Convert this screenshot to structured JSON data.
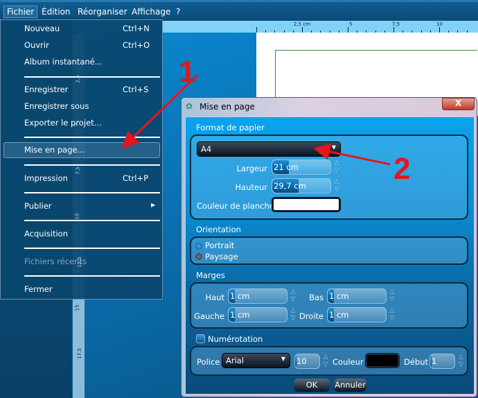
{
  "menubar": {
    "items": [
      "Fichier",
      "Édition",
      "Réorganiser",
      "Affichage",
      "?"
    ]
  },
  "ruler": {
    "top_labels": [
      "2,5 cm",
      "5",
      "7,5",
      "10"
    ],
    "side_labels": [
      "2,5",
      "5",
      "7,5",
      "10",
      "12,5",
      "15",
      "17,5"
    ]
  },
  "file_menu": {
    "items": [
      {
        "label": "Nouveau",
        "shortcut": "Ctrl+N"
      },
      {
        "label": "Ouvrir",
        "shortcut": "Ctrl+O"
      },
      {
        "label": "Album instantané..."
      },
      {
        "label": "Enregistrer",
        "shortcut": "Ctrl+S"
      },
      {
        "label": "Enregistrer sous"
      },
      {
        "label": "Exporter le projet..."
      },
      {
        "label": "Mise en page..."
      },
      {
        "label": "Impression",
        "shortcut": "Ctrl+P"
      },
      {
        "label": "Publier",
        "submenu": true
      },
      {
        "label": "Acquisition"
      },
      {
        "label": "Fichiers récents",
        "disabled": true
      },
      {
        "label": "Fermer"
      }
    ]
  },
  "dialog": {
    "title": "Mise en page",
    "close": "X",
    "paper": {
      "section": "Format de papier",
      "format": "A4",
      "width_label": "Largeur",
      "width": "21 cm",
      "height_label": "Hauteur",
      "height": "29,7 cm",
      "color_label": "Couleur de planche",
      "color": "#ffffff"
    },
    "orientation": {
      "section": "Orientation",
      "options": [
        "Portrait",
        "Paysage"
      ],
      "selected": "Portrait"
    },
    "margins": {
      "section": "Marges",
      "top_label": "Haut",
      "top": "1 cm",
      "bottom_label": "Bas",
      "bottom": "1 cm",
      "left_label": "Gauche",
      "left": "1 cm",
      "right_label": "Droite",
      "right": "1 cm"
    },
    "numbering": {
      "label": "Numérotation",
      "checked": false,
      "font_label": "Police",
      "font": "Arial",
      "size": "10",
      "color_label": "Couleur",
      "color": "#000000",
      "start_label": "Début",
      "start": "1"
    },
    "ok": "OK",
    "cancel": "Annuler"
  },
  "annotations": {
    "step1": "1",
    "step2": "2",
    "color": "#e8141c"
  }
}
